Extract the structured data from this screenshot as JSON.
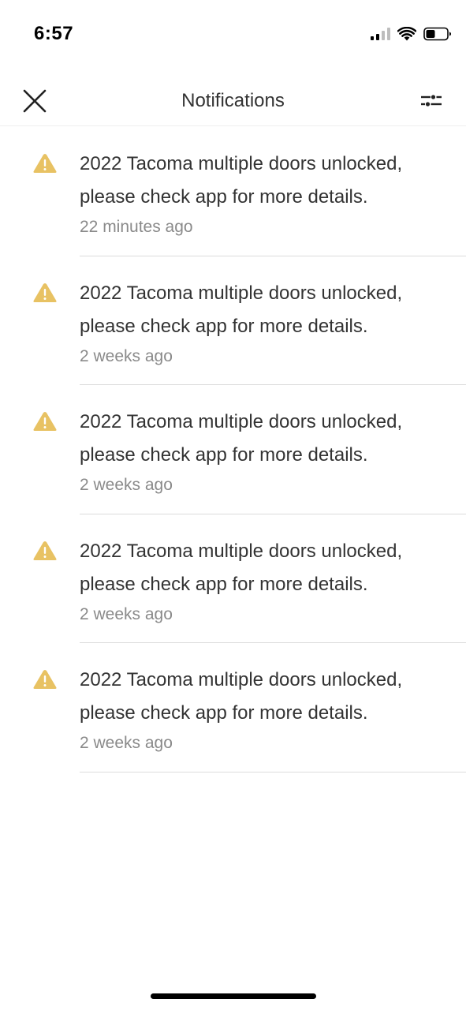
{
  "status_bar": {
    "time": "6:57"
  },
  "header": {
    "title": "Notifications",
    "close_icon": "close-icon",
    "filter_icon": "filter-sliders-icon"
  },
  "colors": {
    "warning": "#E8C263",
    "divider": "#DCDCDC",
    "secondary_text": "#8A8A8A"
  },
  "notifications": [
    {
      "icon": "warning-icon",
      "message": "2022 Tacoma multiple doors unlocked, please check app for more details.",
      "time": "22 minutes ago"
    },
    {
      "icon": "warning-icon",
      "message": "2022 Tacoma multiple doors unlocked, please check app for more details.",
      "time": "2 weeks ago"
    },
    {
      "icon": "warning-icon",
      "message": "2022 Tacoma multiple doors unlocked, please check app for more details.",
      "time": "2 weeks ago"
    },
    {
      "icon": "warning-icon",
      "message": "2022 Tacoma multiple doors unlocked, please check app for more details.",
      "time": "2 weeks ago"
    },
    {
      "icon": "warning-icon",
      "message": "2022 Tacoma multiple doors unlocked, please check app for more details.",
      "time": "2 weeks ago"
    }
  ]
}
